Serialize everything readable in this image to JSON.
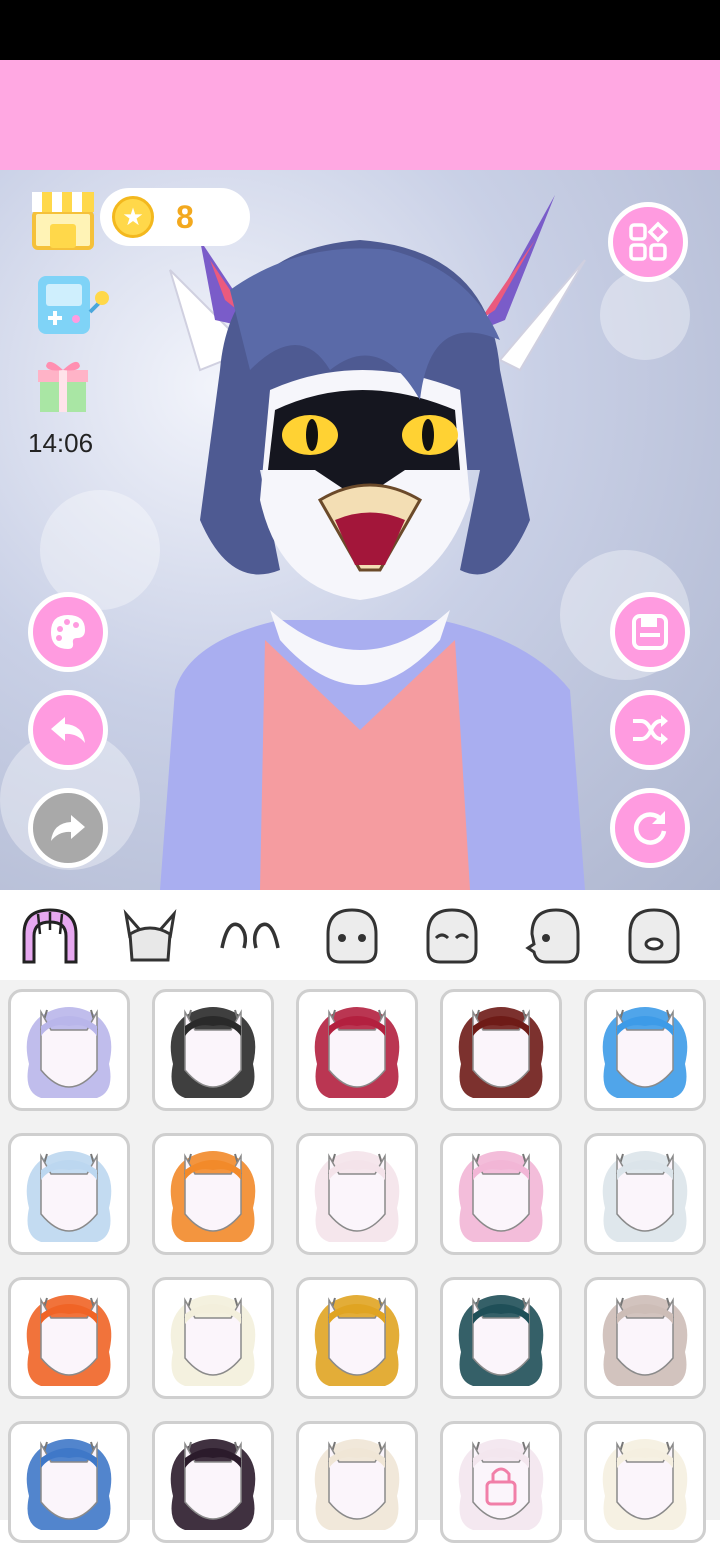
{
  "header": {
    "coins": "8",
    "time": "14:06"
  },
  "icons": {
    "shop": "shop-icon",
    "coin": "coin-star-icon",
    "game": "game-console-icon",
    "gift": "gift-icon",
    "gallery": "grid-menu-icon",
    "palette": "palette-icon",
    "undo": "undo-icon",
    "redo": "redo-icon",
    "save": "save-icon",
    "shuffle": "shuffle-icon",
    "reset": "reset-icon"
  },
  "category_tabs": [
    {
      "name": "hair",
      "selected": true
    },
    {
      "name": "horns",
      "selected": false
    },
    {
      "name": "ears",
      "selected": false
    },
    {
      "name": "face",
      "selected": false
    },
    {
      "name": "eyes",
      "selected": false
    },
    {
      "name": "face-profile",
      "selected": false
    },
    {
      "name": "mouth",
      "selected": false
    }
  ],
  "hair_items": [
    {
      "color": "#b9b6ea",
      "locked": false
    },
    {
      "color": "#2a2a2a",
      "locked": false
    },
    {
      "color": "#b3203f",
      "locked": false
    },
    {
      "color": "#6e1b17",
      "locked": false
    },
    {
      "color": "#3d9be8",
      "locked": false
    },
    {
      "color": "#bcd7f0",
      "locked": false
    },
    {
      "color": "#f28a2a",
      "locked": false
    },
    {
      "color": "#f4e3ea",
      "locked": false
    },
    {
      "color": "#f2b6d6",
      "locked": false
    },
    {
      "color": "#dbe4ea",
      "locked": false
    },
    {
      "color": "#f06426",
      "locked": false
    },
    {
      "color": "#f3efdc",
      "locked": false
    },
    {
      "color": "#e0a422",
      "locked": false
    },
    {
      "color": "#1f4f58",
      "locked": false
    },
    {
      "color": "#cdbdb7",
      "locked": false
    },
    {
      "color": "#3f78c8",
      "locked": false
    },
    {
      "color": "#2b1b2b",
      "locked": false
    },
    {
      "color": "#f0e6d6",
      "locked": false
    },
    {
      "color": "#f3e6ee",
      "locked": true
    },
    {
      "color": "#f5efe0",
      "locked": false
    }
  ],
  "colors": {
    "banner": "#ffa8e2",
    "button": "#ff9be0",
    "disabled_button": "#a9a9a9",
    "coin_text": "#f3a91e"
  }
}
